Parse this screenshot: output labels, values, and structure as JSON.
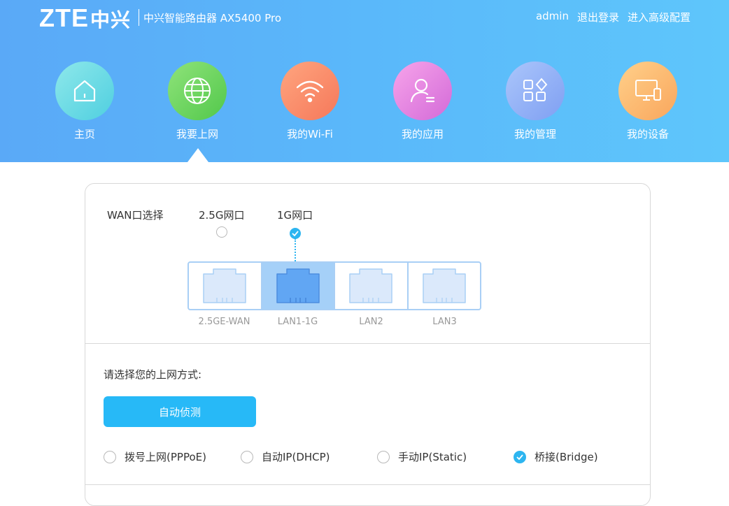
{
  "header": {
    "logo_text": "ZTE",
    "logo_cn": "中兴",
    "product": "中兴智能路由器 AX5400 Pro",
    "user": "admin",
    "logout": "退出登录",
    "advanced": "进入高级配置"
  },
  "nav": {
    "items": [
      {
        "label": "主页",
        "icon": "home-icon",
        "color": "#5ed6dd"
      },
      {
        "label": "我要上网",
        "icon": "globe-icon",
        "color": "#6fd364"
      },
      {
        "label": "我的Wi-Fi",
        "icon": "wifi-icon",
        "color": "#fb8a66"
      },
      {
        "label": "我的应用",
        "icon": "user-app-icon",
        "color": "#e77fdc"
      },
      {
        "label": "我的管理",
        "icon": "manage-grid-icon",
        "color": "#8eb1f6"
      },
      {
        "label": "我的设备",
        "icon": "device-icon",
        "color": "#fdb46b"
      }
    ],
    "active_index": 1
  },
  "wan": {
    "label": "WAN口选择",
    "options": [
      {
        "label": "2.5G网口",
        "checked": false
      },
      {
        "label": "1G网口",
        "checked": true
      }
    ],
    "ports": [
      {
        "name": "2.5GE-WAN",
        "active": false
      },
      {
        "name": "LAN1-1G",
        "active": true
      },
      {
        "name": "LAN2",
        "active": false
      },
      {
        "name": "LAN3",
        "active": false
      }
    ]
  },
  "connection": {
    "prompt": "请选择您的上网方式:",
    "detect_button": "自动侦测",
    "modes": [
      {
        "label": "拨号上网(PPPoE)",
        "checked": false
      },
      {
        "label": "自动IP(DHCP)",
        "checked": false
      },
      {
        "label": "手动IP(Static)",
        "checked": false
      },
      {
        "label": "桥接(Bridge)",
        "checked": true
      }
    ]
  },
  "colors": {
    "accent": "#27b9f7",
    "port_border": "#a9cff5",
    "port_active_bg": "#a5d0f8"
  }
}
